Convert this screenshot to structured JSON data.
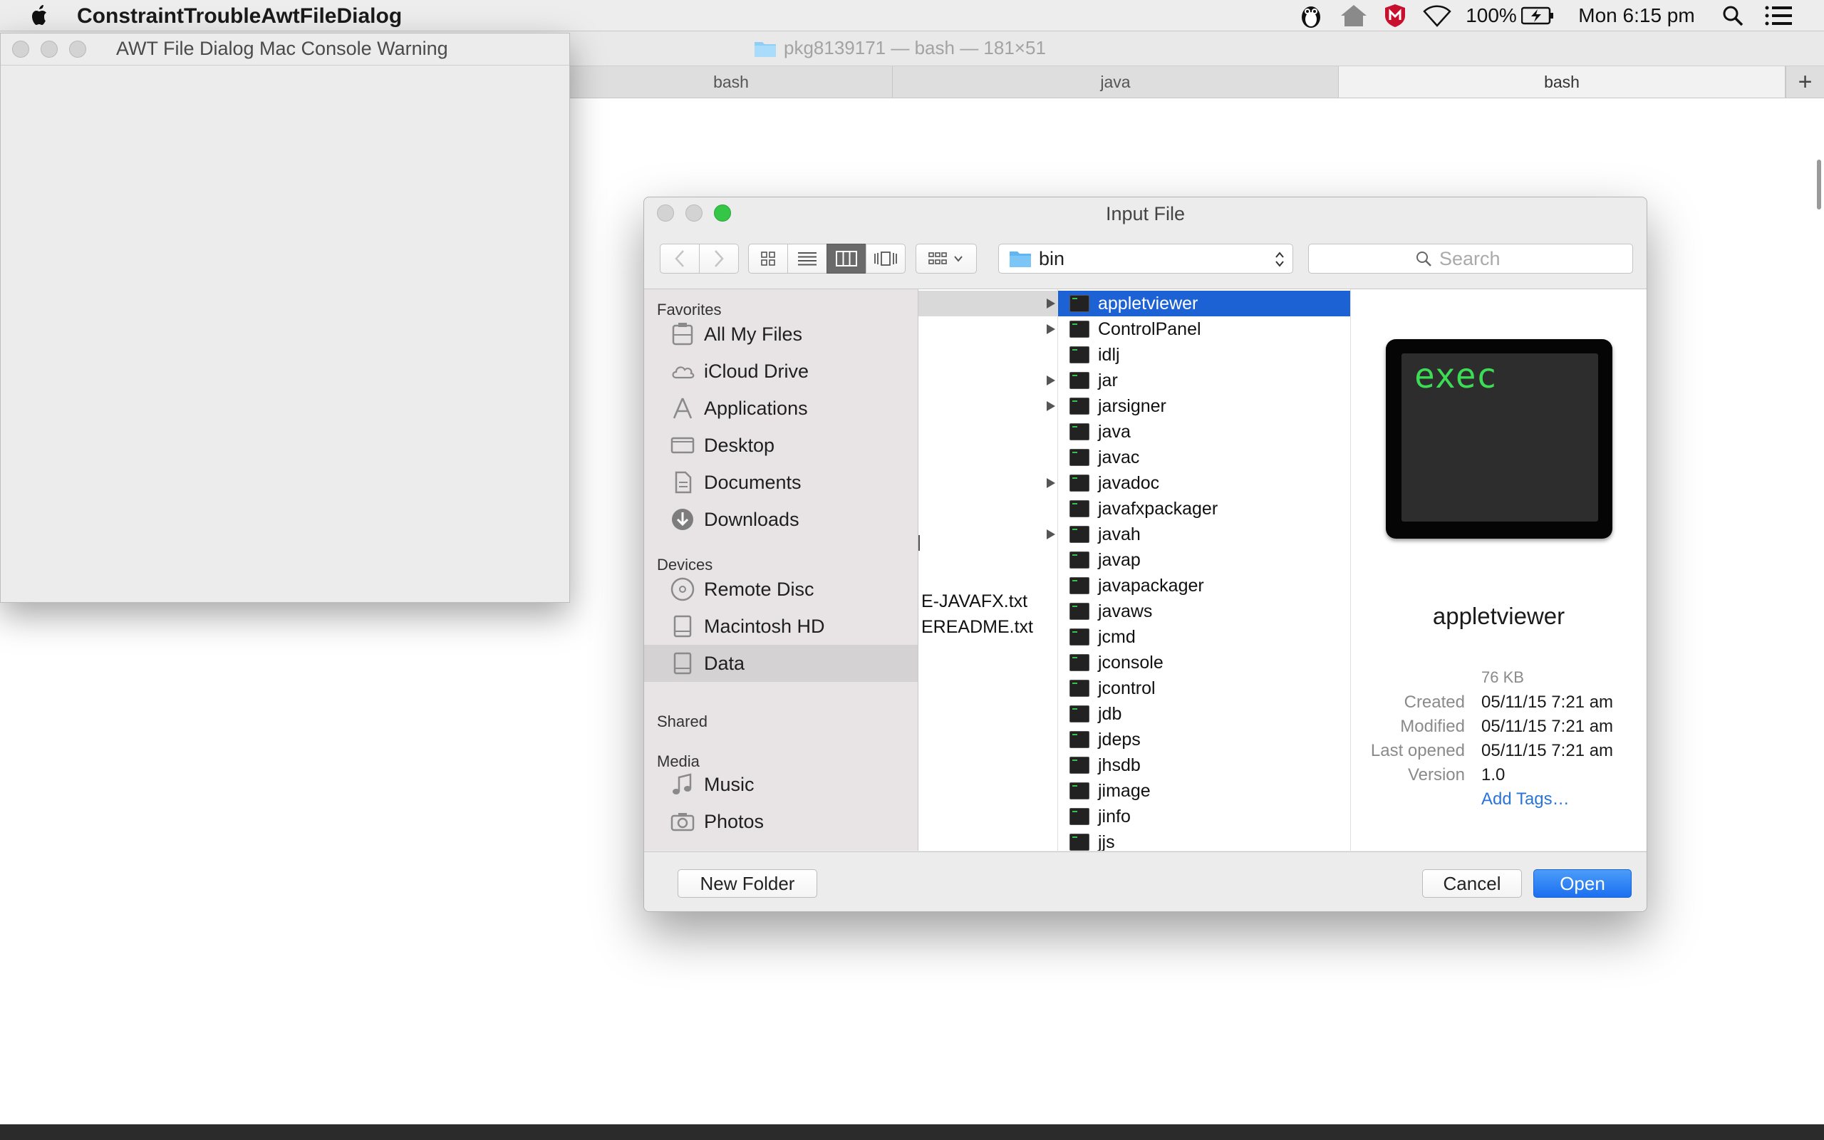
{
  "menubar": {
    "app_name": "ConstraintTroubleAwtFileDialog",
    "battery": "100%",
    "clock": "Mon 6:15 pm"
  },
  "terminal": {
    "title": "pkg8139171 — bash — 181×51",
    "tabs": [
      {
        "label": "bash"
      },
      {
        "label": "java"
      },
      {
        "label": "bash"
      }
    ],
    "new_tab_label": "+"
  },
  "awt_window": {
    "title": "AWT File Dialog Mac Console Warning"
  },
  "dialog": {
    "title": "Input File",
    "current_folder": "bin",
    "search_placeholder": "Search",
    "sidebar": {
      "favorites_header": "Favorites",
      "favorites": [
        {
          "label": "All My Files",
          "icon": "all-files-icon"
        },
        {
          "label": "iCloud Drive",
          "icon": "cloud-icon"
        },
        {
          "label": "Applications",
          "icon": "applications-icon"
        },
        {
          "label": "Desktop",
          "icon": "desktop-icon"
        },
        {
          "label": "Documents",
          "icon": "documents-icon"
        },
        {
          "label": "Downloads",
          "icon": "downloads-icon"
        }
      ],
      "devices_header": "Devices",
      "devices": [
        {
          "label": "Remote Disc",
          "icon": "disc-icon"
        },
        {
          "label": "Macintosh HD",
          "icon": "hard-disk-icon"
        },
        {
          "label": "Data",
          "icon": "hard-disk-icon",
          "selected": true
        }
      ],
      "shared_header": "Shared",
      "media_header": "Media",
      "media": [
        {
          "label": "Music",
          "icon": "music-icon"
        },
        {
          "label": "Photos",
          "icon": "camera-icon"
        }
      ]
    },
    "column1": [
      "E-JAVAFX.txt",
      "EREADME.txt"
    ],
    "files": [
      {
        "name": "appletviewer",
        "folder": true,
        "selected": true
      },
      {
        "name": "ControlPanel",
        "folder": true
      },
      {
        "name": "idlj"
      },
      {
        "name": "jar",
        "folder": true
      },
      {
        "name": "jarsigner",
        "folder": true
      },
      {
        "name": "java"
      },
      {
        "name": "javac"
      },
      {
        "name": "javadoc",
        "folder": true
      },
      {
        "name": "javafxpackager"
      },
      {
        "name": "javah",
        "folder": true
      },
      {
        "name": "javap"
      },
      {
        "name": "javapackager"
      },
      {
        "name": "javaws"
      },
      {
        "name": "jcmd"
      },
      {
        "name": "jconsole"
      },
      {
        "name": "jcontrol"
      },
      {
        "name": "jdb"
      },
      {
        "name": "jdeps"
      },
      {
        "name": "jhsdb"
      },
      {
        "name": "jimage"
      },
      {
        "name": "jinfo"
      },
      {
        "name": "jjs"
      }
    ],
    "preview": {
      "icon_text": "exec",
      "name": "appletviewer",
      "size": "76 KB",
      "created_label": "Created",
      "created": "05/11/15 7:21 am",
      "modified_label": "Modified",
      "modified": "05/11/15 7:21 am",
      "last_opened_label": "Last opened",
      "last_opened": "05/11/15 7:21 am",
      "version_label": "Version",
      "version": "1.0",
      "add_tags": "Add Tags…"
    },
    "buttons": {
      "new_folder": "New Folder",
      "cancel": "Cancel",
      "open": "Open"
    }
  },
  "colors": {
    "selection": "#1d62d4",
    "primary_button": "#1c6ff0",
    "link": "#2a74d8",
    "exec_green": "#3cdc55"
  }
}
